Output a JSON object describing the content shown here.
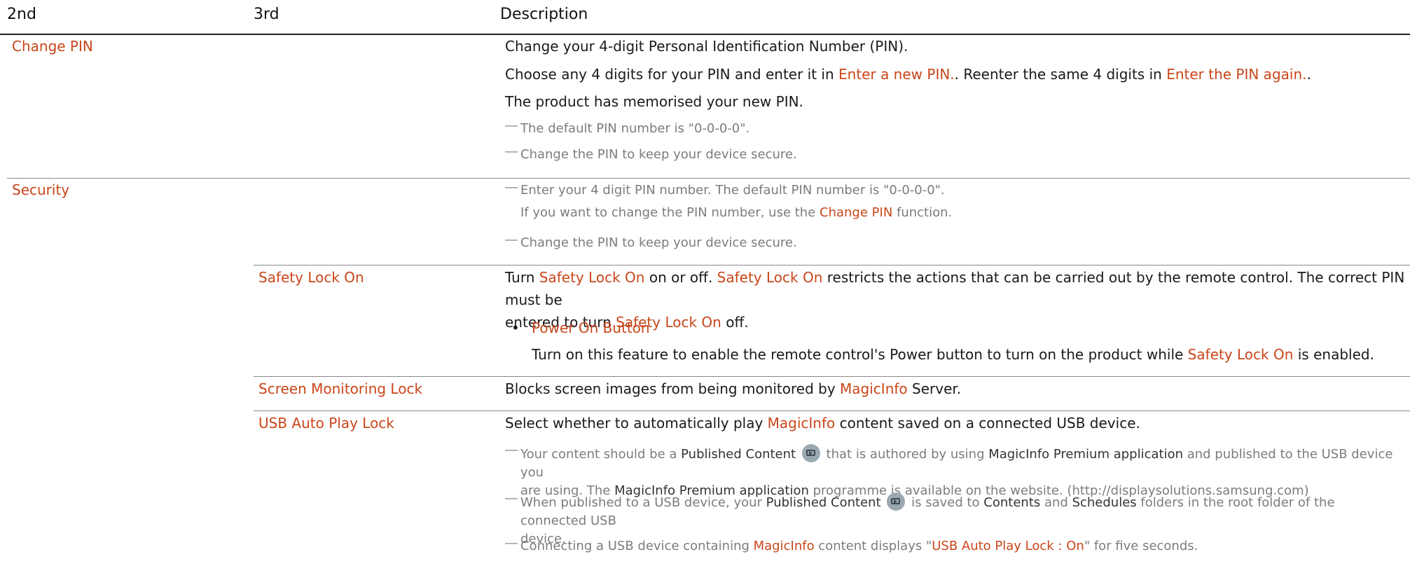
{
  "header": {
    "col2": "2nd",
    "col3": "3rd",
    "col4": "Description"
  },
  "change_pin": {
    "label": "Change PIN",
    "line1": "Change your 4-digit Personal Identification Number (PIN).",
    "line2_a": "Choose any 4 digits for your PIN and enter it in ",
    "line2_b": "Enter a new PIN.",
    "line2_c": ". Reenter the same 4 digits in ",
    "line2_d": "Enter the PIN again.",
    "line2_e": ".",
    "line3": "The product has memorised your new PIN.",
    "note1": "The default PIN number is \"0-0-0-0\".",
    "note2": "Change the PIN to keep your device secure."
  },
  "security": {
    "label": "Security",
    "note1_line1": "Enter your 4 digit PIN number. The default PIN number is \"0-0-0-0\".",
    "note1_line2_a": "If you want to change the PIN number, use the ",
    "note1_line2_b": "Change PIN",
    "note1_line2_c": " function.",
    "note2": "Change the PIN to keep your device secure."
  },
  "safety_lock": {
    "label": "Safety Lock On",
    "p1_a": "Turn ",
    "p1_b": "Safety Lock On",
    "p1_c": " on or off. ",
    "p1_d": "Safety Lock On",
    "p1_e": " restricts the actions that can be carried out by the remote control. The correct PIN must be",
    "p2_a": "entered to turn ",
    "p2_b": "Safety Lock On",
    "p2_c": " off.",
    "bullet_char": "•",
    "bullet_label": "Power On Button",
    "bullet_desc_a": "Turn on this feature to enable the remote control's Power button to turn on the product while ",
    "bullet_desc_b": "Safety Lock On",
    "bullet_desc_c": " is enabled."
  },
  "screen_lock": {
    "label": "Screen Monitoring Lock",
    "desc_a": "Blocks screen images from being monitored by ",
    "desc_b": "MagicInfo",
    "desc_c": " Server."
  },
  "usb_lock": {
    "label": "USB Auto Play Lock",
    "desc_a": "Select whether to automatically play ",
    "desc_b": "MagicInfo",
    "desc_c": " content saved on a connected USB device.",
    "n1_a": "Your content should be a ",
    "n1_b": "Published Content",
    "n1_c": " that is authored by using ",
    "n1_d": "MagicInfo Premium application",
    "n1_e": " and published to the USB device you",
    "n1_f": "are using. The ",
    "n1_g": "MagicInfo Premium application",
    "n1_h": " programme is available on the website. (http://displaysolutions.samsung.com)",
    "n2_a": "When published to a USB device, your ",
    "n2_b": "Published Content",
    "n2_c": " is saved to ",
    "n2_d": "Contents",
    "n2_e": " and ",
    "n2_f": "Schedules",
    "n2_g": " folders in the root folder of the connected USB",
    "n2_h": "device.",
    "n3_a": "Connecting a USB device containing ",
    "n3_b": "MagicInfo",
    "n3_c": " content displays \"",
    "n3_d": "USB Auto Play Lock : On",
    "n3_e": "\" for five seconds."
  },
  "note_dash": "―"
}
